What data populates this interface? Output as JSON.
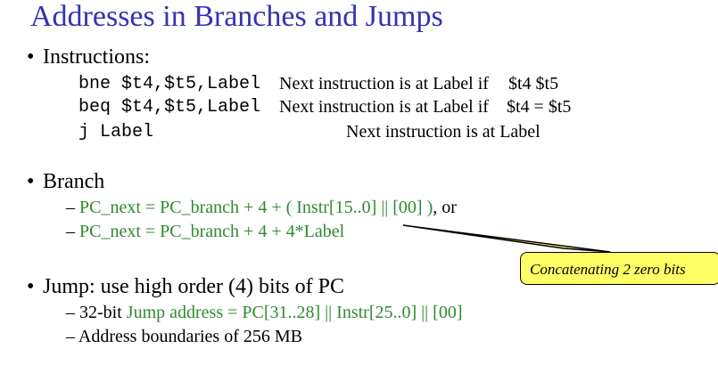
{
  "title": "Addresses in Branches and Jumps",
  "instructions": {
    "heading": "Instructions:",
    "rows": [
      {
        "code": "bne $t4,$t5,Label",
        "desc": "Next instruction is at Label if",
        "tail": "$t4   $t5"
      },
      {
        "code": "beq $t4,$t5,Label",
        "desc": "Next instruction is at Label if",
        "tail": "$t4 = $t5"
      },
      {
        "code": "j Label",
        "desc": "Next instruction is at Label",
        "tail": ""
      }
    ]
  },
  "branch": {
    "heading": "Branch",
    "lines": [
      {
        "dash": "–",
        "green": "PC_next = PC_branch + 4 + ( Instr[15..0]  ||  [00] )",
        "black": ", or"
      },
      {
        "dash": "–",
        "green": "PC_next = PC_branch + 4 + 4*Label",
        "black": ""
      }
    ]
  },
  "callout": {
    "text": "Concatenating 2 zero bits"
  },
  "jump": {
    "heading": "Jump: use high order (4) bits of PC",
    "lines": [
      {
        "dash": "–",
        "black": "32-bit ",
        "green": "Jump address = PC[31..28]  ||  Instr[25..0]  ||  [00]"
      },
      {
        "dash": "–",
        "black": "Address boundaries of 256 MB",
        "green": ""
      }
    ]
  },
  "bullet_glyph": "•",
  "colors": {
    "title": "#3333b3",
    "accent_green": "#2f8a2f",
    "callout_bg": "#ffff66"
  }
}
